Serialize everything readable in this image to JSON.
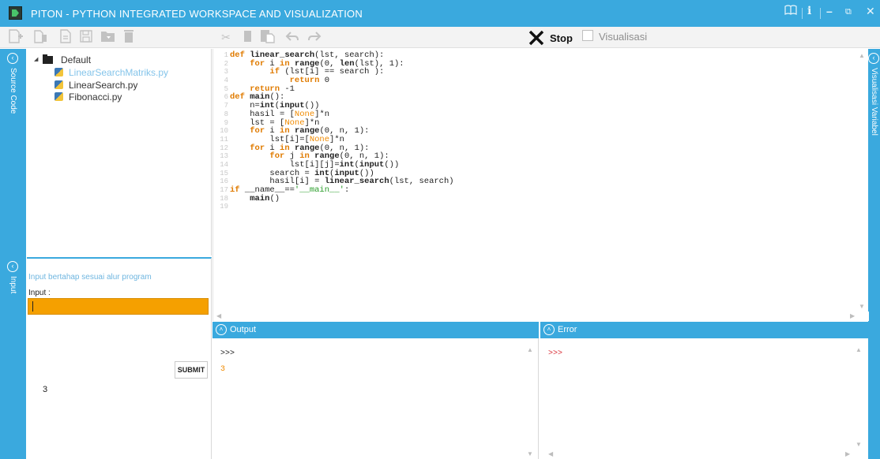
{
  "window": {
    "title": "PITON - PYTHON INTEGRATED WORKSPACE AND VISUALIZATION",
    "controls": [
      "book-icon",
      "info-icon",
      "minimize-icon",
      "restore-icon",
      "close-icon"
    ]
  },
  "toolbar": {
    "file_buttons": [
      "new-file-icon",
      "delete-file-icon",
      "blank-file-icon",
      "save-icon",
      "open-folder-icon",
      "trash-icon"
    ],
    "edit_buttons": [
      "cut-icon",
      "copy-icon",
      "paste-icon",
      "undo-icon",
      "redo-icon"
    ],
    "stop_label": "Stop",
    "visualisasi_label": "Visualisasi",
    "visualisasi_checked": false
  },
  "left_strip": {
    "source_code_label": "Source Code",
    "input_label": "Input"
  },
  "right_strip": {
    "label": "Visualisasi Variabel"
  },
  "file_tree": {
    "folder": "Default",
    "files": [
      {
        "name": "LinearSearchMatriks.py",
        "active": true
      },
      {
        "name": "LinearSearch.py",
        "active": false
      },
      {
        "name": "Fibonacci.py",
        "active": false
      }
    ]
  },
  "input_panel": {
    "hint": "Input bertahap sesuai alur program",
    "label": "Input :",
    "value": "",
    "submit_label": "SUBMIT",
    "history": "3"
  },
  "editor": {
    "line_numbers": [
      "1",
      "2",
      "3",
      "4",
      "5",
      "6",
      "7",
      "8",
      "9",
      "10",
      "11",
      "12",
      "13",
      "14",
      "15",
      "16",
      "17",
      "18",
      "19"
    ]
  },
  "output": {
    "label": "Output",
    "prompt": ">>>",
    "value": "3"
  },
  "error": {
    "label": "Error",
    "prompt": ">>>"
  },
  "colors": {
    "accent": "#3aa9de",
    "input_highlight": "#f5a000",
    "keyword": "#e07b00",
    "string": "#2a9d2a",
    "error_prompt": "#d9323a"
  }
}
